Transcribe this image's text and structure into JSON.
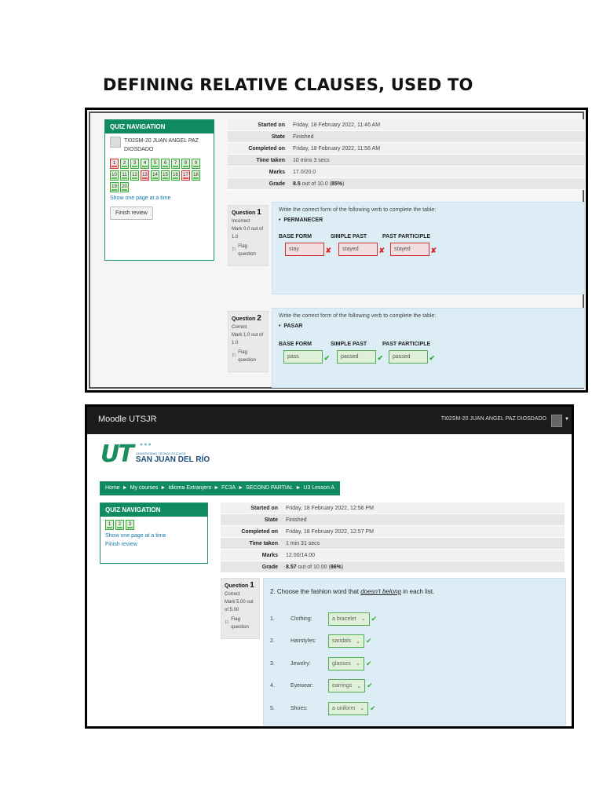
{
  "doc_title": "DEFINING RELATIVE CLAUSES, USED TO",
  "shot1": {
    "nav": {
      "header": "QUIZ NAVIGATION",
      "user": "TI02SM-20 JUAN ANGEL PAZ DIOSDADO",
      "questions": [
        {
          "n": "1",
          "status": "wrong"
        },
        {
          "n": "2",
          "status": "ok"
        },
        {
          "n": "3",
          "status": "ok"
        },
        {
          "n": "4",
          "status": "ok"
        },
        {
          "n": "5",
          "status": "ok"
        },
        {
          "n": "6",
          "status": "ok"
        },
        {
          "n": "7",
          "status": "ok"
        },
        {
          "n": "8",
          "status": "ok"
        },
        {
          "n": "9",
          "status": "ok"
        },
        {
          "n": "10",
          "status": "ok"
        },
        {
          "n": "11",
          "status": "ok"
        },
        {
          "n": "12",
          "status": "ok"
        },
        {
          "n": "13",
          "status": "wrong"
        },
        {
          "n": "14",
          "status": "ok"
        },
        {
          "n": "15",
          "status": "ok"
        },
        {
          "n": "16",
          "status": "ok"
        },
        {
          "n": "17",
          "status": "wrong"
        },
        {
          "n": "18",
          "status": "ok"
        },
        {
          "n": "19",
          "status": "ok"
        },
        {
          "n": "20",
          "status": "ok"
        }
      ],
      "show_link": "Show one page at a time",
      "finish_label": "Finish review"
    },
    "summary": [
      {
        "k": "Started on",
        "v": "Friday, 18 February 2022, 11:46 AM"
      },
      {
        "k": "State",
        "v": "Finished"
      },
      {
        "k": "Completed on",
        "v": "Friday, 18 February 2022, 11:56 AM"
      },
      {
        "k": "Time taken",
        "v": "10 mins 3 secs"
      },
      {
        "k": "Marks",
        "v": "17.0/20.0"
      },
      {
        "k": "Grade",
        "v_bold": "8.5",
        "v_rest": " out of 10.0 (",
        "v_pct": "85%",
        "v_end": ")"
      }
    ],
    "q1": {
      "label": "Question",
      "num": "1",
      "status": "Incorrect",
      "mark": "Mark 0.0 out of 1.0",
      "flag": "Flag question",
      "prompt": "Write the correct form of the following verb to complete the table:",
      "verb": "PERMANECER",
      "cols": [
        "BASE FORM",
        "SIMPLE PAST",
        "PAST PARTICIPLE"
      ],
      "answers": [
        "stay",
        "stayed",
        "stayed"
      ]
    },
    "q2": {
      "label": "Question",
      "num": "2",
      "status": "Correct",
      "mark": "Mark 1.0 out of 1.0",
      "flag": "Flag question",
      "prompt": "Write the correct form of the following verb to complete the table:",
      "verb": "PASAR",
      "cols": [
        "BASE FORM",
        "SIMPLE PAST",
        "PAST PARTICIPLE"
      ],
      "answers": [
        "pass",
        "passed",
        "passed"
      ]
    },
    "colors": {
      "wrong": "#d9534f",
      "ok": "#5cb85c",
      "nav_green": "#0f8a61",
      "question_bg": "#dcedf6"
    }
  },
  "shot2": {
    "brand": "Moodle UTSJR",
    "user": "TI02SM-20 JUAN ANGEL PAZ DIOSDADO",
    "logo": {
      "mark": "UT",
      "small": "Universidad Tecnológica de",
      "big": "SAN JUAN DEL RÍO"
    },
    "breadcrumb": [
      "Home",
      "My courses",
      "Idioma Extranjero",
      "FC3A",
      "SECOND PARTIAL",
      "U3 Lesson A"
    ],
    "nav": {
      "header": "QUIZ NAVIGATION",
      "questions": [
        "1",
        "2",
        "3"
      ],
      "show_link": "Show one page at a time",
      "finish_link": "Finish review"
    },
    "summary": [
      {
        "k": "Started on",
        "v": "Friday, 18 February 2022, 12:56 PM"
      },
      {
        "k": "State",
        "v": "Finished"
      },
      {
        "k": "Completed on",
        "v": "Friday, 18 February 2022, 12:57 PM"
      },
      {
        "k": "Time taken",
        "v": "1 min 31 secs"
      },
      {
        "k": "Marks",
        "v": "12.00/14.00"
      },
      {
        "k": "Grade",
        "v_bold": "8.57",
        "v_rest": " out of 10.00 (",
        "v_pct": "86%",
        "v_end": ")"
      }
    ],
    "q1": {
      "label": "Question",
      "num": "1",
      "status": "Correct",
      "mark": "Mark 5.00 out of 5.00",
      "flag": "Flag question",
      "prompt_pre": "2. Choose the fashion word that ",
      "prompt_em": "doesn't belong",
      "prompt_post": " in each list.",
      "items": [
        {
          "n": "1.",
          "cat": "Clothing:",
          "sel": "a bracelet"
        },
        {
          "n": "2.",
          "cat": "Hairstyles:",
          "sel": "sandals"
        },
        {
          "n": "3.",
          "cat": "Jewelry:",
          "sel": "glasses"
        },
        {
          "n": "4.",
          "cat": "Eyewear:",
          "sel": "earrings"
        },
        {
          "n": "5.",
          "cat": "Shoes:",
          "sel": "a uniform"
        }
      ]
    }
  }
}
